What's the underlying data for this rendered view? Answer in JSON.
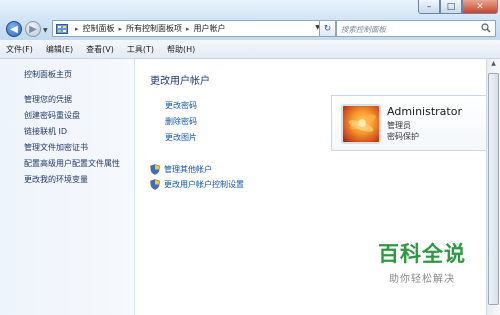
{
  "address": {
    "crumbs": [
      "控制面板",
      "所有控制面板项",
      "用户帐户"
    ]
  },
  "search": {
    "placeholder": "搜索控制面板"
  },
  "menu": [
    "文件(F)",
    "编辑(E)",
    "查看(V)",
    "工具(T)",
    "帮助(H)"
  ],
  "left": {
    "home": "控制面板主页",
    "links": [
      "管理您的凭据",
      "创建密码重设盘",
      "链接联机 ID",
      "管理文件加密证书",
      "配置高级用户配置文件属性",
      "更改我的环境变量"
    ]
  },
  "main": {
    "title": "更改用户帐户",
    "links": [
      "更改密码",
      "删除密码",
      "更改图片"
    ],
    "shield_links": [
      "管理其他帐户",
      "更改用户帐户控制设置"
    ]
  },
  "account": {
    "name": "Administrator",
    "role": "管理员",
    "status": "密码保护"
  },
  "watermark": {
    "main": "百科全说",
    "sub": "助你轻松解决"
  }
}
